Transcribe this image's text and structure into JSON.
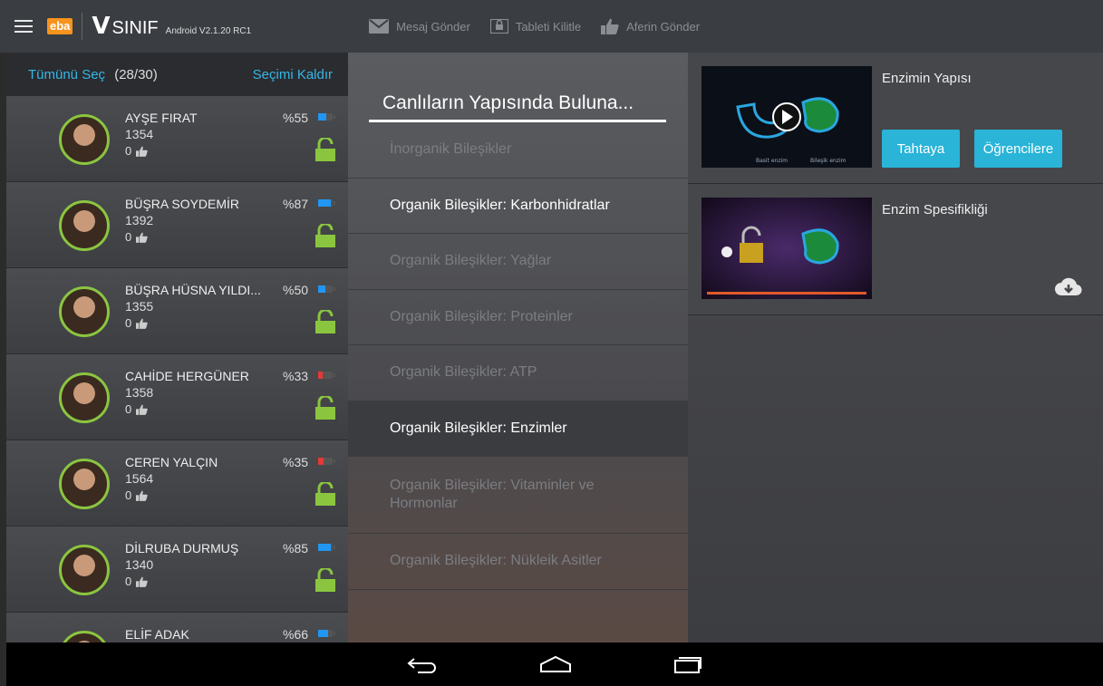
{
  "app": {
    "brand": "eba",
    "name": "SINIF",
    "version": "Android V2.1.20 RC1"
  },
  "toolbar": {
    "send_message": "Mesaj Gönder",
    "lock_tablet": "Tableti Kilitle",
    "send_praise": "Aferin Gönder"
  },
  "students_panel": {
    "select_all": "Tümünü Seç",
    "count": "(28/30)",
    "deselect": "Seçimi Kaldır",
    "students": [
      {
        "name": "AYŞE FIRAT",
        "number": "1354",
        "likes": "0",
        "battery": "%55",
        "battery_level": 0.55,
        "battery_color": "#2196f3"
      },
      {
        "name": "BÜŞRA SOYDEMİR",
        "number": "1392",
        "likes": "0",
        "battery": "%87",
        "battery_level": 0.87,
        "battery_color": "#2196f3"
      },
      {
        "name": "BÜŞRA HÜSNA YILDI...",
        "number": "1355",
        "likes": "0",
        "battery": "%50",
        "battery_level": 0.5,
        "battery_color": "#2196f3"
      },
      {
        "name": "CAHİDE HERGÜNER",
        "number": "1358",
        "likes": "0",
        "battery": "%33",
        "battery_level": 0.33,
        "battery_color": "#e53935"
      },
      {
        "name": "CEREN YALÇIN",
        "number": "1564",
        "likes": "0",
        "battery": "%35",
        "battery_level": 0.35,
        "battery_color": "#e53935"
      },
      {
        "name": "DİLRUBA DURMUŞ",
        "number": "1340",
        "likes": "0",
        "battery": "%85",
        "battery_level": 0.85,
        "battery_color": "#2196f3"
      },
      {
        "name": "ELİF ADAK",
        "number": "",
        "likes": "",
        "battery": "%66",
        "battery_level": 0.66,
        "battery_color": "#2196f3"
      }
    ]
  },
  "topics_panel": {
    "title": "Canlıların Yapısında Buluna...",
    "topics": [
      {
        "label": "İnorganik Bileşikler"
      },
      {
        "label": "Organik Bileşikler: Karbonhidratlar"
      },
      {
        "label": "Organik Bileşikler: Yağlar"
      },
      {
        "label": "Organik Bileşikler: Proteinler"
      },
      {
        "label": "Organik Bileşikler: ATP"
      },
      {
        "label": "Organik Bileşikler: Enzimler"
      },
      {
        "label": "Organik Bileşikler: Vitaminler ve Hormonlar"
      },
      {
        "label": "Organik Bileşikler: Nükleik Asitler"
      }
    ]
  },
  "videos_panel": {
    "videos": [
      {
        "title": "Enzimin Yapısı",
        "caption_left": "Basit enzim",
        "caption_right": "Bileşik enzim",
        "board_button": "Tahtaya",
        "students_button": "Öğrencilere"
      },
      {
        "title": "Enzim Spesifikliği"
      }
    ]
  },
  "colors": {
    "accent": "#29b4d8",
    "link": "#35b7e8",
    "avatar_ring": "#8bc540",
    "lock": "#8bc540"
  }
}
